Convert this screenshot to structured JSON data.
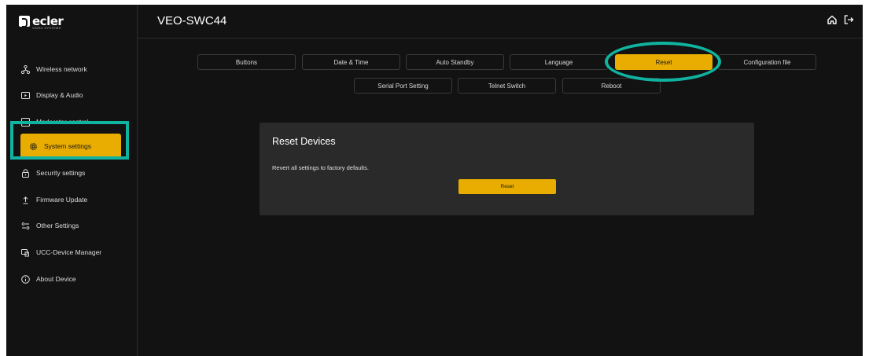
{
  "brand": {
    "name": "ecler",
    "tagline": "VIDEO SYSTEMS"
  },
  "header": {
    "title": "VEO-SWC44",
    "home_icon": "home-icon",
    "logout_icon": "logout-icon"
  },
  "sidebar": {
    "items": [
      {
        "label": "Wireless network",
        "icon": "network-icon"
      },
      {
        "label": "Display & Audio",
        "icon": "display-icon"
      },
      {
        "label": "Moderator control",
        "icon": "square-icon"
      },
      {
        "label": "System settings",
        "icon": "gear-icon",
        "active": true
      },
      {
        "label": "Security settings",
        "icon": "lock-icon"
      },
      {
        "label": "Firmware Update",
        "icon": "upload-icon"
      },
      {
        "label": "Other Settings",
        "icon": "sliders-icon"
      },
      {
        "label": "UCC-Device Manager",
        "icon": "device-icon"
      },
      {
        "label": "About Device",
        "icon": "info-icon"
      }
    ]
  },
  "tabs": {
    "row1": [
      "Buttons",
      "Date & Time",
      "Auto Standby",
      "Language",
      "Reset",
      "Configuration file"
    ],
    "row2": [
      "Serial Port Setting",
      "Telnet Switch",
      "Reboot"
    ],
    "active": "Reset"
  },
  "panel": {
    "title": "Reset Devices",
    "description": "Revert all settings to factory defaults.",
    "button_label": "Reset"
  },
  "colors": {
    "accent": "#e8ad00",
    "highlight": "#10b3a0",
    "background": "#121212",
    "panel": "#2a2a2a"
  }
}
